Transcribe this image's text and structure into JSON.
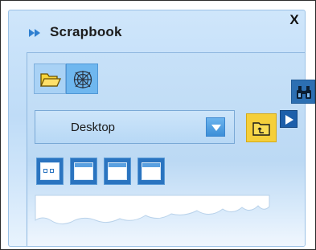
{
  "panel": {
    "title": "Scrapbook",
    "close_label": "X"
  },
  "toolbar": {
    "open_folder_icon": "folder-open-icon",
    "web_icon": "web-capture-icon",
    "search_icon": "binoculars-icon"
  },
  "location": {
    "selected": "Desktop",
    "dropdown_icon": "chevron-down-icon",
    "up_icon": "folder-up-icon",
    "more_icon": "triangle-right-icon"
  },
  "views": [
    {
      "name": "view-thumbnails",
      "icon": "thumbnail-view-icon"
    },
    {
      "name": "view-window-1",
      "icon": "window-icon"
    },
    {
      "name": "view-window-2",
      "icon": "window-icon"
    },
    {
      "name": "view-window-3",
      "icon": "window-icon"
    }
  ],
  "colors": {
    "panel_bg": "#c7e1f8",
    "accent": "#2a74c0",
    "folder": "#f5cf3a"
  }
}
